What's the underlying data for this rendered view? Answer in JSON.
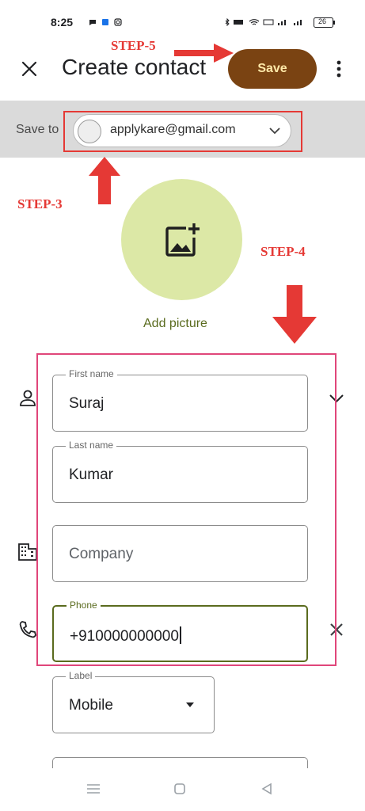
{
  "status_bar": {
    "time": "8:25",
    "battery": "26",
    "icons": [
      "notification-icon",
      "bluetooth-icon",
      "wifi-icon",
      "signal-icon"
    ]
  },
  "app_bar": {
    "title": "Create contact",
    "save_label": "Save",
    "save_color": "#7a4312"
  },
  "save_to": {
    "label": "Save to",
    "account_email": "applykare@gmail.com"
  },
  "photo": {
    "add_picture_label": "Add picture",
    "circle_color": "#dce8a6"
  },
  "fields": {
    "first_name": {
      "label": "First name",
      "value": "Suraj"
    },
    "last_name": {
      "label": "Last name",
      "value": "Kumar"
    },
    "company": {
      "placeholder": "Company"
    },
    "phone": {
      "label": "Phone",
      "value": "+910000000000"
    },
    "phone_label": {
      "label": "Label",
      "value": "Mobile"
    }
  },
  "annotations": {
    "step3": "STEP-3",
    "step4": "STEP-4",
    "step5": "STEP-5",
    "color": "#e53935"
  }
}
